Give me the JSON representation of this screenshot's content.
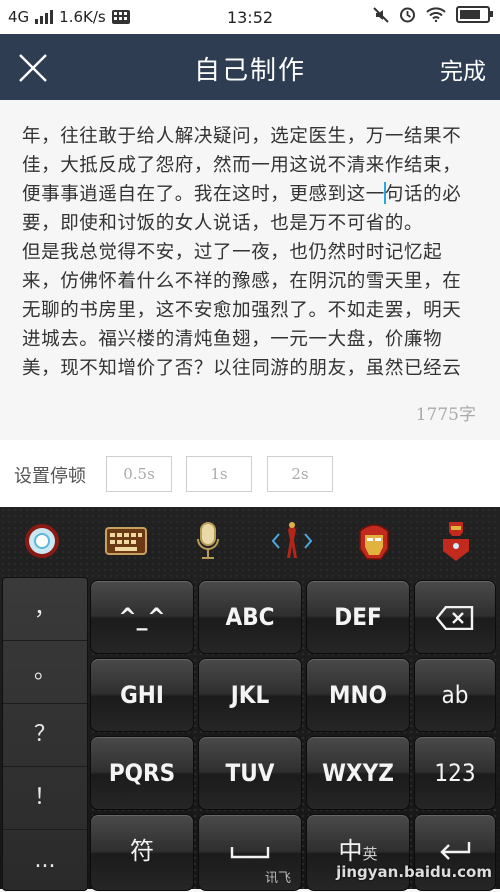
{
  "status_bar": {
    "network": "4G",
    "speed": "1.6K/s",
    "time": "13:52"
  },
  "header": {
    "title": "自己制作",
    "done_label": "完成"
  },
  "editor": {
    "paragraph1_before_caret": "年，往往敢于给人解决疑问，选定医生，万一结果不佳，大抵反成了怨府，然而一用这说不清来作结束，便事事逍遥自在了。我在这时，更感到这一",
    "paragraph1_after_caret": "句话的必要，即使和讨饭的女人说话，也是万不可省的。",
    "paragraph2": "但是我总觉得不安，过了一夜，也仍然时时记忆起来，仿佛怀着什么不祥的豫感，在阴沉的雪天里，在无聊的书房里，这不安愈加强烈了。不如走罢，明天进城去。福兴楼的清炖鱼翅，一元一大盘，价廉物美，现不知增价了否？以往同游的朋友，虽然已经云",
    "char_count": "1775字"
  },
  "pause": {
    "label": "设置停顿",
    "options": [
      "0.5s",
      "1s",
      "2s"
    ]
  },
  "keyboard": {
    "symbols": [
      "，",
      "。",
      "？",
      "！",
      "..."
    ],
    "rows": [
      [
        "^_^",
        "ABC",
        "DEF"
      ],
      [
        "GHI",
        "JKL",
        "MNO",
        "ab"
      ],
      [
        "PQRS",
        "TUV",
        "WXYZ",
        "123"
      ]
    ],
    "bottom": {
      "symbol_key": "符",
      "space_sub": "讯飞",
      "lang_key": "中",
      "lang_sub": "英"
    },
    "watermark": "jingyan.baidu.com"
  }
}
